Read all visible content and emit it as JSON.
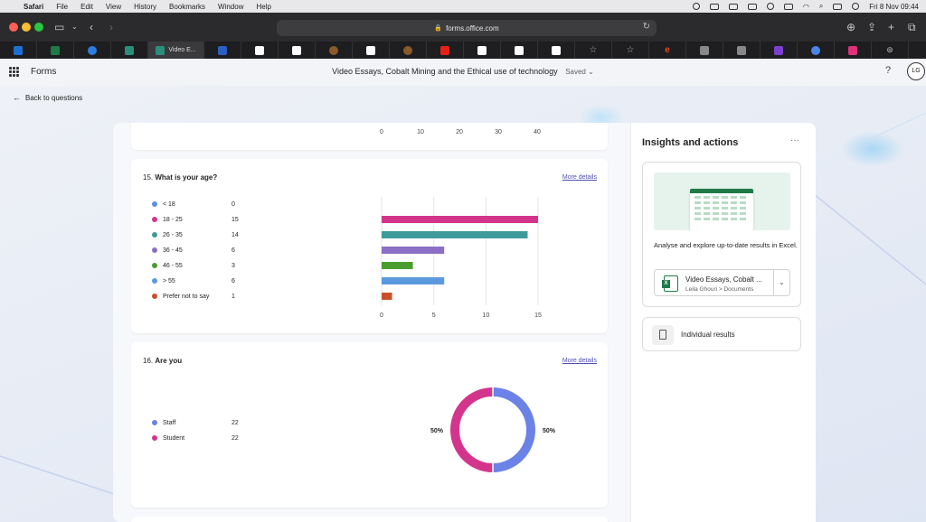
{
  "menubar": {
    "items": [
      "Safari",
      "File",
      "Edit",
      "View",
      "History",
      "Bookmarks",
      "Window",
      "Help"
    ],
    "datetime": "Fri 8 Nov  09:44"
  },
  "browser": {
    "url": "forms.office.com",
    "active_tab": "Video E..."
  },
  "app": {
    "name": "Forms",
    "title": "Video Essays, Cobalt Mining and the Ethical use of technology",
    "saved": "Saved",
    "help": "?",
    "avatar": "LG"
  },
  "back_link": "Back to questions",
  "prev_chart": {
    "ticks": [
      "0",
      "10",
      "20",
      "30",
      "40"
    ]
  },
  "q15": {
    "number": "15.",
    "title": "What is your age?",
    "more_details": "More details",
    "chart_data": {
      "type": "bar",
      "orientation": "horizontal",
      "categories": [
        "< 18",
        "18 - 25",
        "26 - 35",
        "36 - 45",
        "46 - 55",
        "> 55",
        "Prefer not to say"
      ],
      "values": [
        0,
        15,
        14,
        6,
        3,
        6,
        1
      ],
      "colors": [
        "#5b8fe0",
        "#d4358c",
        "#3f9b9a",
        "#8b6fc4",
        "#4a9e2f",
        "#5b99df",
        "#c8512a"
      ],
      "ticks": [
        "0",
        "5",
        "10",
        "15"
      ],
      "xlim": [
        0,
        15
      ],
      "grid": true
    }
  },
  "q16": {
    "number": "16.",
    "title": "Are you",
    "more_details": "More details",
    "chart_data": {
      "type": "pie",
      "variant": "donut",
      "categories": [
        "Staff",
        "Student"
      ],
      "values": [
        22,
        22
      ],
      "colors": [
        "#6b82e6",
        "#d4358c"
      ],
      "labels": [
        "50%",
        "50%"
      ]
    }
  },
  "insights": {
    "title": "Insights and actions",
    "more": "···",
    "description": "Analyse and explore up-to-date results in Excel.",
    "file_name": "Video Essays, Cobalt ...",
    "file_path": "Leila Ghouri > Documents",
    "individual_results": "Individual results"
  }
}
